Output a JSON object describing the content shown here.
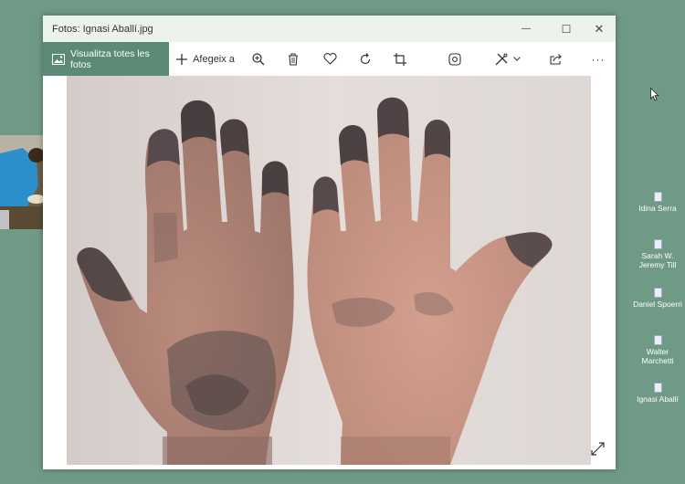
{
  "window": {
    "title": "Fotos: Ignasi Aballí.jpg",
    "controls": {
      "minimize": "—",
      "maximize": "☐",
      "close": "✕"
    }
  },
  "toolbar": {
    "view_all_label": "Visualitza totes les fotos",
    "add_to_label": "Afegeix a",
    "more_label": "···"
  },
  "photo": {
    "subject": "Two hands stained with dark ink, palms facing forward"
  },
  "desktop_icons": [
    {
      "label": "Idina Serra"
    },
    {
      "label": "Sarah W. Jeremy Till"
    },
    {
      "label": "Daniel Spoerri"
    },
    {
      "label": "Walter Marchetti"
    },
    {
      "label": "Ignasi Aballí"
    }
  ],
  "colors": {
    "desktop": "#6f9a85",
    "accent": "#5b8a76",
    "titlebar": "#ebf3ec"
  }
}
